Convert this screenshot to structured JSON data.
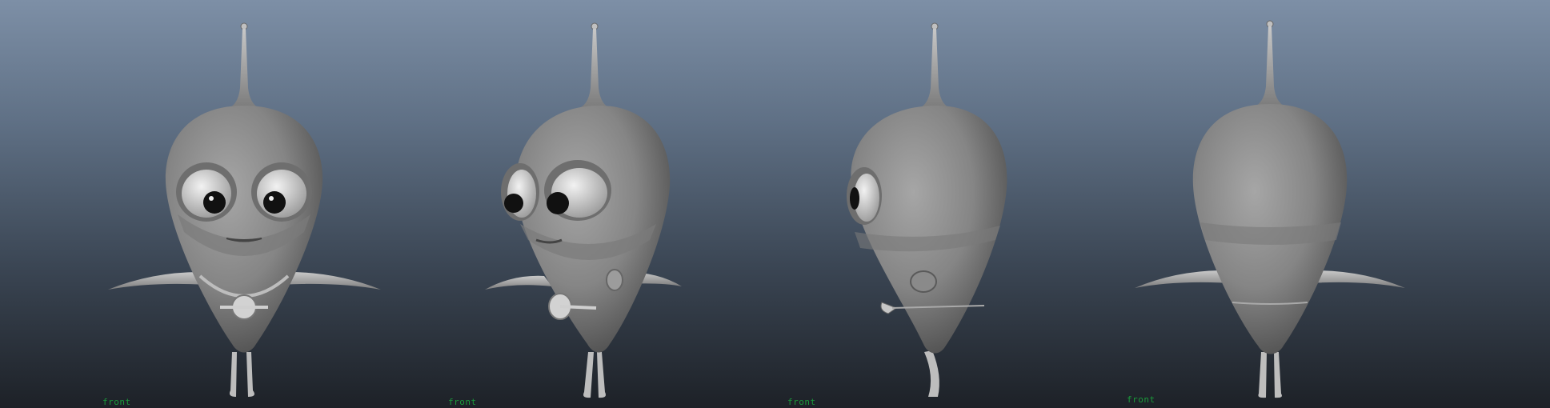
{
  "viewport": {
    "camera_labels": [
      "front",
      "front",
      "front",
      "front"
    ],
    "label_color": "#1a9a3a",
    "model_views": [
      "front-view",
      "three-quarter-view",
      "side-view",
      "back-view"
    ]
  }
}
